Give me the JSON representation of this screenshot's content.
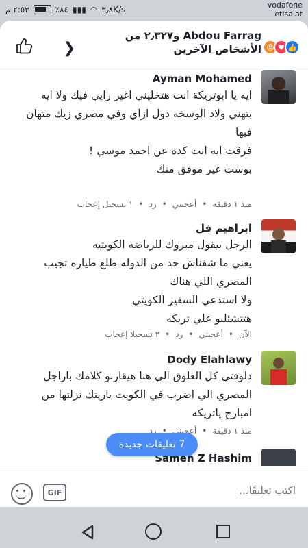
{
  "status_bar": {
    "time": "٢:٥٣ م",
    "battery": "٪٨٤",
    "network_speed": "٣٫٨K/s",
    "carrier_line1": "vodafone",
    "carrier_line2": "etisalat"
  },
  "header": {
    "reactions_title": "Abdou Farrag و٢٫٣٢٧ من الأشخاص الآخرين",
    "reaction_icons": [
      "angry-icon",
      "love-icon",
      "like-icon"
    ],
    "colors": {
      "like": "#1877f2",
      "love": "#f33e58",
      "angry": "#f08b2a"
    }
  },
  "comments": [
    {
      "name": "Ayman Mohamed",
      "lines": [
        "ايه يا ابوتريكة انت هتخليني اغير رايي فيك ولا ايه",
        "بتهني ولاد الوسخة دول ازاي وفي مصري زيك متهان فيها",
        "فرقت ايه انت كدة عن احمد موسي !",
        "بوست غير موفق منك"
      ],
      "time": "منذ ١ دقيقة",
      "like_label": "أعجبني",
      "reply_label": "رد",
      "like_count": "١ تسجيل إعجاب"
    },
    {
      "name": "ابراهيم فل",
      "lines": [
        "الرجل بيقول مبروك للرياضه الكويتيه",
        "يعني ما شفناش حد من الدوله طلع طياره تجيب المصري اللي هناك",
        "ولا استدعي السفير الكويتي",
        "هتتشئلبو علي تريكه"
      ],
      "time": "الآن",
      "like_label": "أعجبني",
      "reply_label": "رد",
      "like_count": "٢ تسجيلا إعجاب"
    },
    {
      "name": "Dody Elahlawy",
      "lines": [
        "دلوقتي كل العلوق الي هنا هيقارنو كلامك باراجل المصري الي اضرب في الكويت ياريتك نزلتها من امبارح ياتريكه"
      ],
      "time": "منذ ١ دقيقة",
      "like_label": "أعجبني",
      "reply_label": "رد"
    }
  ],
  "partial_comment_name": "Sameh Z Hashim",
  "new_comments_pill": "7 تعليقات جديدة",
  "composer": {
    "placeholder": "اكتب تعليقًا...",
    "gif_label": "GIF"
  }
}
